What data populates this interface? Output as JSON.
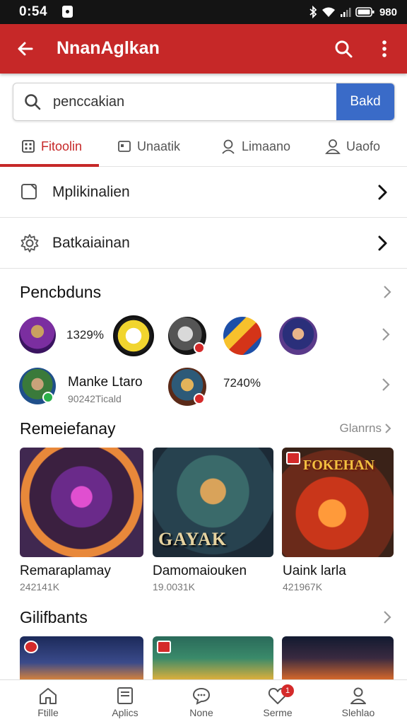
{
  "status_bar": {
    "time": "0:54",
    "battery": "980"
  },
  "app_bar": {
    "title": "NnanAglkan"
  },
  "search": {
    "value": "penccakian",
    "button_label": "Bakd"
  },
  "tabs": [
    {
      "label": "Fitoolin",
      "icon": "grid-icon",
      "active": true
    },
    {
      "label": "Unaatik",
      "icon": "card-icon",
      "active": false
    },
    {
      "label": "Limaano",
      "icon": "person-icon",
      "active": false
    },
    {
      "label": "Uaofo",
      "icon": "user-icon",
      "active": false
    }
  ],
  "menu": [
    {
      "label": "Mplikinalien",
      "icon": "app-icon"
    },
    {
      "label": "Batkaiainan",
      "icon": "gear-icon"
    }
  ],
  "section_players": {
    "title": "Pencbduns",
    "stat_1": "1329%",
    "person_name": "Manke Ltaro",
    "person_sub": "90242Ticald",
    "stat_2": "7240%"
  },
  "section_recommended": {
    "title": "Remeiefanay",
    "see_all": "Glanrns",
    "cards": [
      {
        "title": "Remaraplamay",
        "sub": "242141K",
        "overlay": ""
      },
      {
        "title": "Damomaiouken",
        "sub": "19.0031K",
        "overlay": "GAYAK"
      },
      {
        "title": "Uaink larla",
        "sub": "421967K",
        "overlay": "FOKEHAN"
      }
    ]
  },
  "section_gifts": {
    "title": "Gilifbants"
  },
  "bottom_nav": [
    {
      "label": "Ftille",
      "icon": "home-icon",
      "badge": ""
    },
    {
      "label": "Aplics",
      "icon": "apps-icon",
      "badge": ""
    },
    {
      "label": "None",
      "icon": "chat-icon",
      "badge": ""
    },
    {
      "label": "Serme",
      "icon": "heart-icon",
      "badge": "1"
    },
    {
      "label": "Slehlao",
      "icon": "profile-icon",
      "badge": ""
    }
  ],
  "colors": {
    "primary": "#c62828",
    "button": "#3a6bc8",
    "status_bar": "#141414"
  }
}
